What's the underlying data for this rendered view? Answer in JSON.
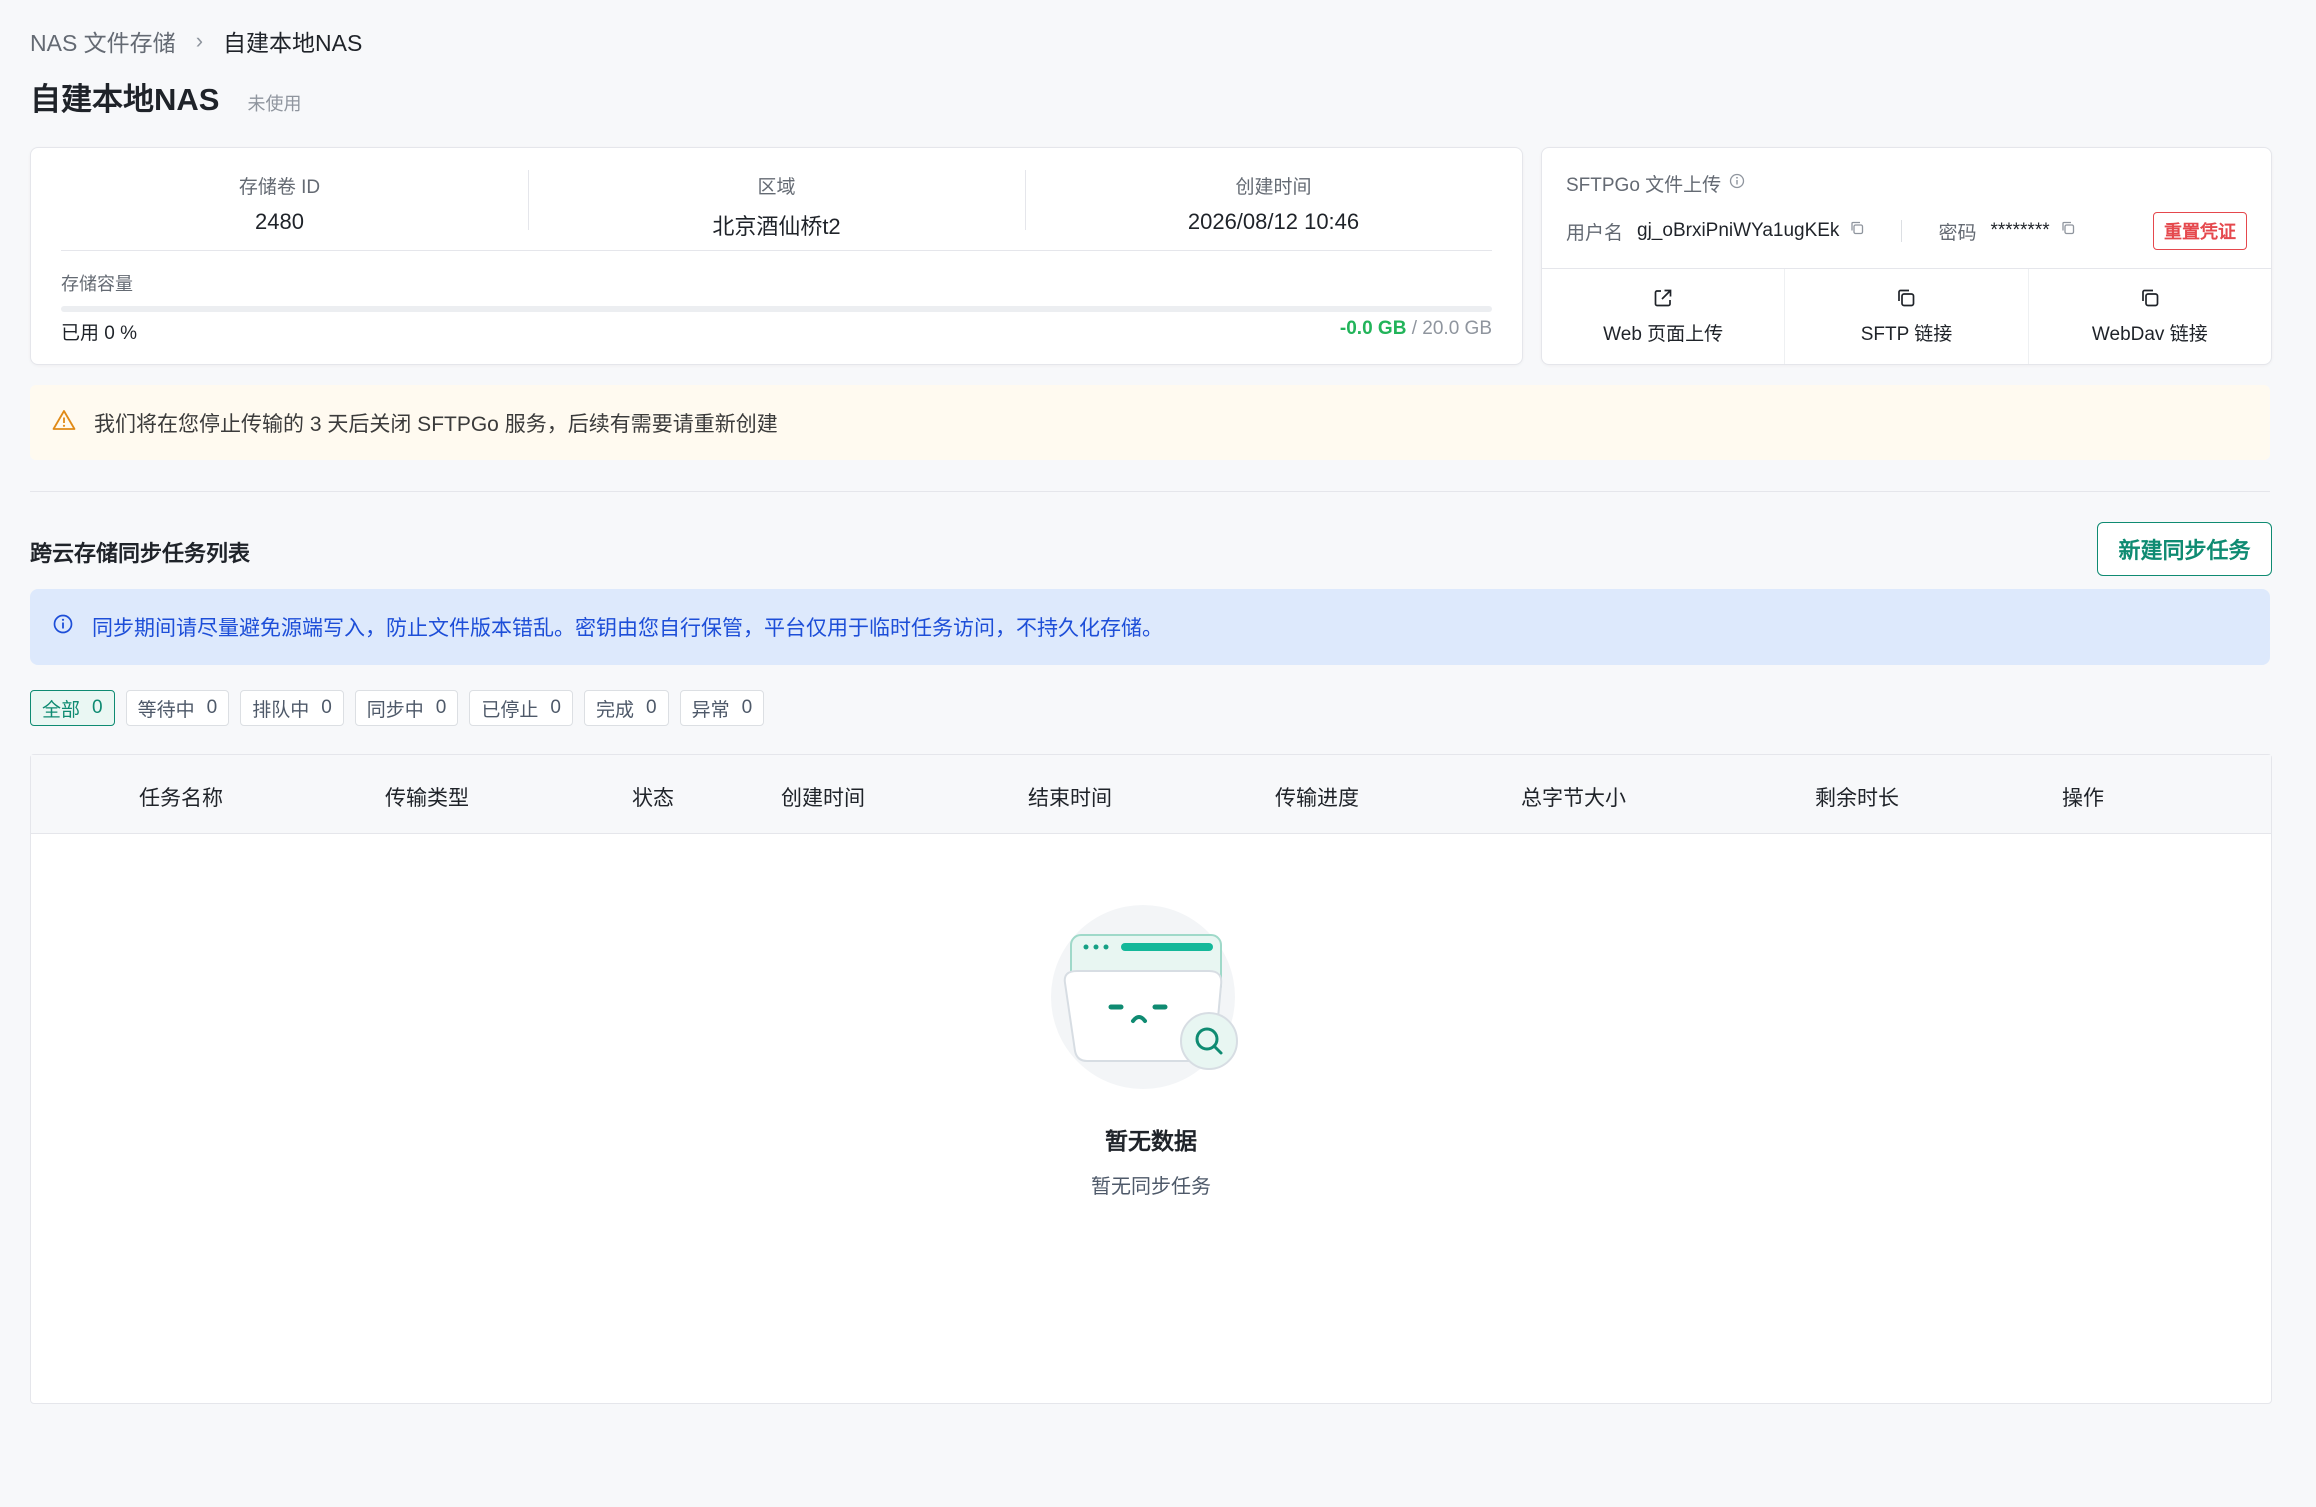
{
  "breadcrumb": {
    "root": "NAS 文件存储",
    "separator": "›",
    "current": "自建本地NAS"
  },
  "page": {
    "title": "自建本地NAS",
    "status_tag": "未使用"
  },
  "info": {
    "volume_id_label": "存储卷 ID",
    "volume_id": "2480",
    "region_label": "区域",
    "region": "北京酒仙桥t2",
    "created_label": "创建时间",
    "created": "2026/08/12 10:46",
    "capacity_label": "存储容量",
    "used_text": "已用 0 %",
    "used_percent": 0,
    "used_size": "-0.0 GB",
    "capacity_sep": " / ",
    "total_size": "20.0 GB"
  },
  "sftp": {
    "title": "SFTPGo 文件上传",
    "username_label": "用户名",
    "username": "gj_oBrxiPniWYa1ugKEk",
    "password_label": "密码",
    "password": "********",
    "reset_label": "重置凭证",
    "actions": [
      {
        "label": "Web 页面上传",
        "icon": "external-link-icon"
      },
      {
        "label": "SFTP 链接",
        "icon": "copy-icon"
      },
      {
        "label": "WebDav 链接",
        "icon": "copy-icon"
      }
    ]
  },
  "warning": {
    "text": "我们将在您停止传输的 3 天后关闭 SFTPGo 服务，后续有需要请重新创建"
  },
  "sync": {
    "section_title": "跨云存储同步任务列表",
    "new_button": "新建同步任务",
    "notice": "同步期间请尽量避免源端写入，防止文件版本错乱。密钥由您自行保管，平台仅用于临时任务访问，不持久化存储。",
    "filters": [
      {
        "label": "全部",
        "count": "0"
      },
      {
        "label": "等待中",
        "count": "0"
      },
      {
        "label": "排队中",
        "count": "0"
      },
      {
        "label": "同步中",
        "count": "0"
      },
      {
        "label": "已停止",
        "count": "0"
      },
      {
        "label": "完成",
        "count": "0"
      },
      {
        "label": "异常",
        "count": "0"
      }
    ],
    "columns": [
      "任务名称",
      "传输类型",
      "状态",
      "创建时间",
      "结束时间",
      "传输进度",
      "总字节大小",
      "剩余时长",
      "操作"
    ],
    "empty_title": "暂无数据",
    "empty_subtitle": "暂无同步任务"
  },
  "colors": {
    "accent": "#0f8b72",
    "used_green": "#22b45a",
    "danger": "#e5484d",
    "info_bg": "#dde9fc",
    "info_text": "#1d4ed8",
    "warn_bg": "#fffaf0",
    "warn_icon": "#e08a17"
  }
}
